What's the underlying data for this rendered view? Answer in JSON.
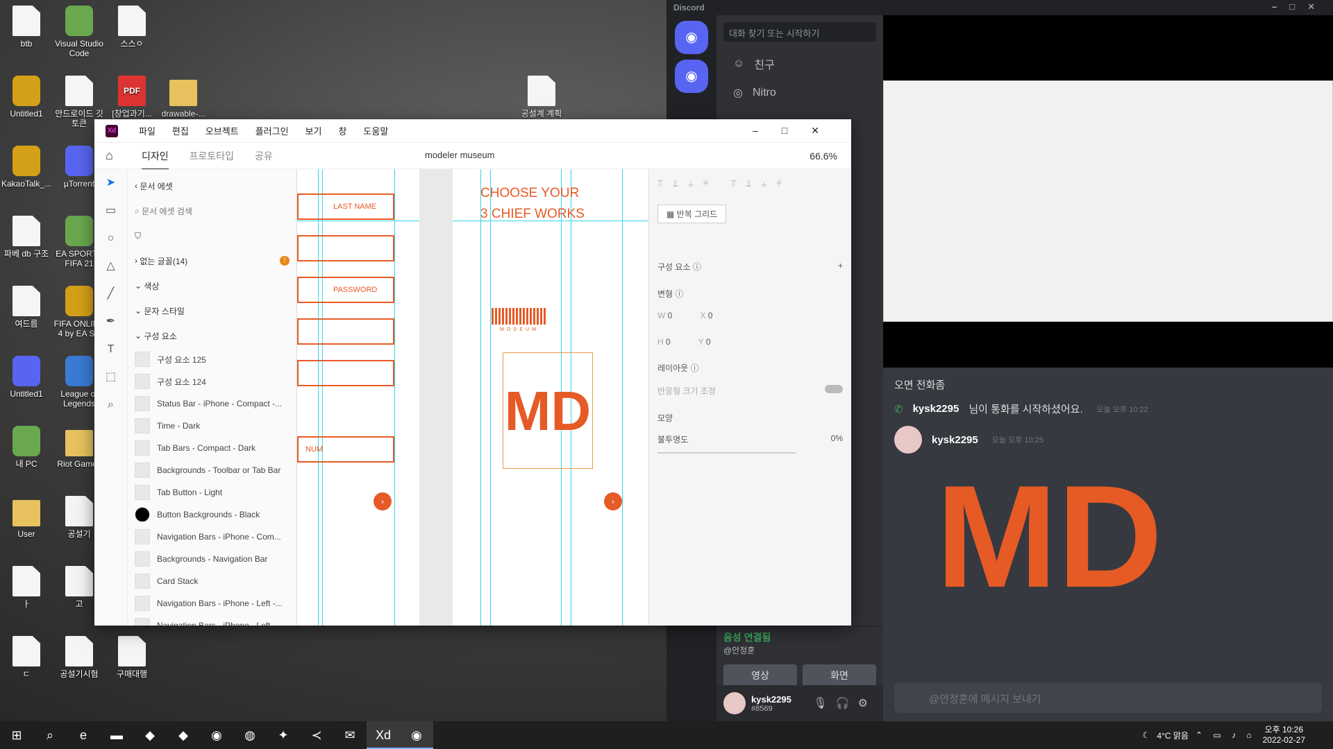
{
  "desktop": {
    "icons": [
      {
        "label": "btb",
        "type": "file"
      },
      {
        "label": "Visual Studio Code",
        "type": "app"
      },
      {
        "label": "스스ㅇ",
        "type": "file"
      },
      {
        "label": "Untitled1",
        "type": "app"
      },
      {
        "label": "안드로이드 깃 토큰",
        "type": "file"
      },
      {
        "label": "[창업과기...",
        "type": "pdf"
      },
      {
        "label": "drawable-...",
        "type": "folder"
      },
      {
        "label": "공설계 계획",
        "type": "file"
      },
      {
        "label": "KakaoTalk_...",
        "type": "app"
      },
      {
        "label": "µTorrent",
        "type": "app"
      },
      {
        "label": "파베 db 구조",
        "type": "file"
      },
      {
        "label": "EA SPORTS FIFA 21",
        "type": "app"
      },
      {
        "label": "여드름",
        "type": "file"
      },
      {
        "label": "FIFA ONLINE 4 by EA SP",
        "type": "app"
      },
      {
        "label": "Untitled1",
        "type": "app"
      },
      {
        "label": "League of Legends",
        "type": "app"
      },
      {
        "label": "내 PC",
        "type": "app"
      },
      {
        "label": "Riot Games",
        "type": "folder"
      },
      {
        "label": "User",
        "type": "folder"
      },
      {
        "label": "공설기",
        "type": "file"
      },
      {
        "label": "ㅏ",
        "type": "file"
      },
      {
        "label": "고",
        "type": "file"
      },
      {
        "label": "ㄷ",
        "type": "file"
      },
      {
        "label": "공설기시험",
        "type": "file"
      },
      {
        "label": "구매대행",
        "type": "file"
      }
    ]
  },
  "discord": {
    "title": "Discord",
    "search_placeholder": "대화 찾기 또는 시작하기",
    "nav": [
      "친구",
      "Nitro"
    ],
    "voice_status": "음성 연결됨",
    "voice_channel": "@안정훈",
    "video_label": "영상",
    "screen_label": "화면",
    "user_name": "kysk2295",
    "user_tag": "#8569",
    "messages": [
      {
        "name": "",
        "text": "오면 전화좀",
        "time": ""
      },
      {
        "name": "kysk2295",
        "text": "님이 통화를 시작하셨어요.",
        "time": "오늘 오후 10:22"
      },
      {
        "name": "kysk2295",
        "text": "",
        "time": "오늘 오후 10:25"
      }
    ],
    "input_placeholder": "@안정훈에 메시지 보내기"
  },
  "xd": {
    "menu": [
      "파일",
      "편집",
      "오브젝트",
      "플러그인",
      "보기",
      "창",
      "도움말"
    ],
    "tabs": [
      "디자인",
      "프로토타입",
      "공유"
    ],
    "doc_name": "modeler museum",
    "zoom": "66.6%",
    "assets": {
      "back_label": "문서 에셋",
      "search_placeholder": "문서 에셋 검색",
      "missing_fonts": "없는 글꼴(14)",
      "sections": [
        "색상",
        "문자 스타일",
        "구성 요소"
      ],
      "components": [
        "구성 요소 125",
        "구성 요소 124",
        "Status Bar - iPhone - Compact -...",
        "Time - Dark",
        "Tab Bars - Compact - Dark",
        "Backgrounds - Toolbar or Tab Bar",
        "Tab Button - Light",
        "Button Backgrounds - Black",
        "Navigation Bars - iPhone - Com...",
        "Backgrounds - Navigation Bar",
        "Card Stack",
        "Navigation Bars - iPhone - Left -...",
        "Navigation Bars - iPhone - Left -..."
      ]
    },
    "canvas": {
      "fields": [
        "LAST NAME",
        "PASSWORD",
        "NUM"
      ],
      "headline_1": "CHOOSE YOUR",
      "headline_2": "3 CHIEF WORKS",
      "brand": "MODEUM",
      "logo": "MD"
    },
    "props": {
      "repeat_grid": "반복 그리드",
      "component": "구성 요소",
      "transform": "변형",
      "w": "W",
      "w_val": "0",
      "x": "X",
      "x_val": "0",
      "h": "H",
      "h_val": "0",
      "y": "Y",
      "y_val": "0",
      "layout": "레이아웃",
      "responsive": "반응형 크기 조정",
      "appearance": "모양",
      "opacity": "불투명도",
      "opacity_val": "0%"
    },
    "accent_color": "#e65a25"
  },
  "taskbar": {
    "weather": "4°C 맑음",
    "time": "오후 10:26",
    "date": "2022-02-27"
  }
}
